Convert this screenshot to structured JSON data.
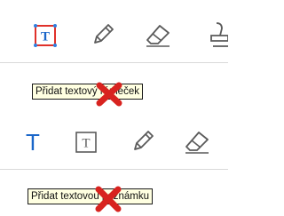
{
  "colors": {
    "accent_blue": "#1a66c9",
    "selection_red": "#e0312a",
    "selection_handle": "#2f7fe0",
    "icon_gray": "#5a5a5a",
    "tooltip_bg": "#ffffe1",
    "cross_mark": "#d8231f"
  },
  "toolbar_top": {
    "tools": [
      {
        "name": "text-box-tool",
        "icon": "text-box-icon",
        "state": "selected"
      },
      {
        "name": "pencil-tool",
        "icon": "pencil-icon"
      },
      {
        "name": "eraser-tool",
        "icon": "eraser-icon"
      },
      {
        "name": "stamp-tool",
        "icon": "stamp-icon",
        "clipped": true
      }
    ],
    "tooltip_text": "Přidat textový rámeček"
  },
  "toolbar_bottom": {
    "tools": [
      {
        "name": "text-note-tool",
        "icon": "text-t-icon"
      },
      {
        "name": "text-box-tool",
        "icon": "text-box-icon"
      },
      {
        "name": "pencil-tool",
        "icon": "pencil-icon"
      },
      {
        "name": "eraser-tool",
        "icon": "eraser-icon"
      }
    ],
    "tooltip_text": "Přidat textovou poznámku"
  }
}
